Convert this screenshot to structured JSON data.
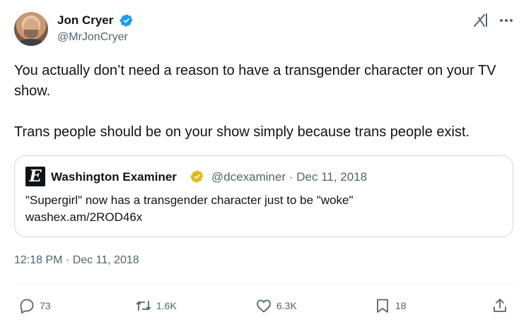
{
  "author": {
    "name": "Jon Cryer",
    "handle": "@MrJonCryer"
  },
  "tweet": {
    "text": "You actually don’t need a reason to have a transgender character on your TV show.\n\nTrans people should be on your show simply because trans people exist.",
    "timestamp": "12:18 PM · Dec 11, 2018"
  },
  "quote": {
    "logo_letter": "E",
    "name": "Washington Examiner",
    "handle_date": "@dcexaminer · Dec 11, 2018",
    "text": "\"Supergirl\" now has a transgender character just to be \"woke\"\nwashex.am/2ROD46x"
  },
  "actions": {
    "replies": "73",
    "reposts": "1.6K",
    "likes": "6.3K",
    "bookmarks": "18"
  },
  "colors": {
    "verified_blue": "#1d9bf0",
    "verified_gold": "#e2b719",
    "secondary_text": "#536471"
  },
  "icons": [
    "verified-badge-icon",
    "grok-icon",
    "more-icon",
    "reply-icon",
    "repost-icon",
    "like-icon",
    "bookmark-icon",
    "share-icon"
  ]
}
